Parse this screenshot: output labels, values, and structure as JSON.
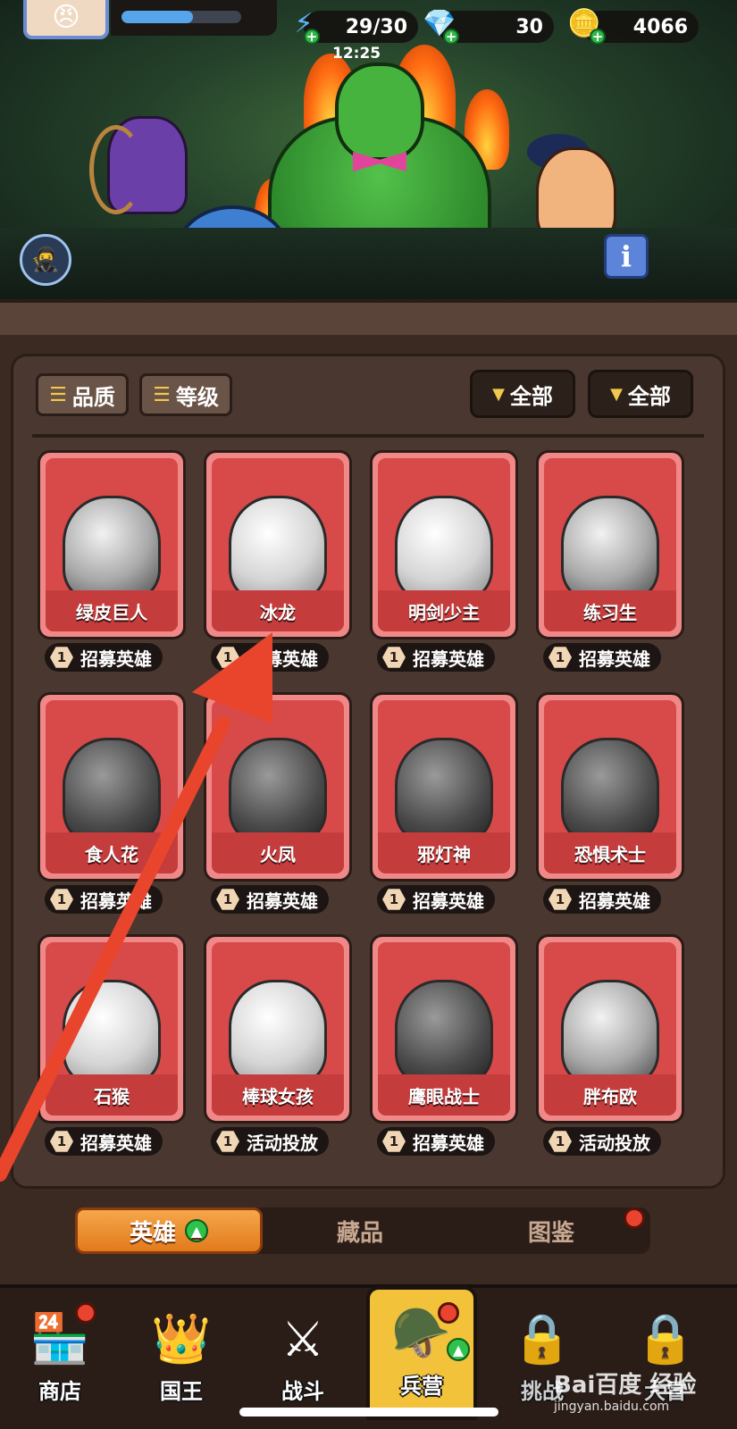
{
  "hud": {
    "energy": "29/30",
    "energy_timer": "12:25",
    "gems": "30",
    "gold": "4066",
    "xp_fraction": 0.6
  },
  "filters": {
    "quality_label": "品质",
    "level_label": "等级",
    "dropdown1_label": "全部",
    "dropdown2_label": "全部"
  },
  "heroes": [
    {
      "name": "绿皮巨人",
      "count": "1",
      "status": "招募英雄"
    },
    {
      "name": "冰龙",
      "count": "1",
      "status": "招募英雄"
    },
    {
      "name": "明剑少主",
      "count": "1",
      "status": "招募英雄"
    },
    {
      "name": "练习生",
      "count": "1",
      "status": "招募英雄"
    },
    {
      "name": "食人花",
      "count": "1",
      "status": "招募英雄"
    },
    {
      "name": "火凤",
      "count": "1",
      "status": "招募英雄"
    },
    {
      "name": "邪灯神",
      "count": "1",
      "status": "招募英雄"
    },
    {
      "name": "恐惧术士",
      "count": "1",
      "status": "招募英雄"
    },
    {
      "name": "石猴",
      "count": "1",
      "status": "招募英雄"
    },
    {
      "name": "棒球女孩",
      "count": "1",
      "status": "活动投放"
    },
    {
      "name": "鹰眼战士",
      "count": "1",
      "status": "招募英雄"
    },
    {
      "name": "胖布欧",
      "count": "1",
      "status": "活动投放"
    }
  ],
  "subtabs": {
    "heroes": "英雄",
    "collection": "藏品",
    "codex": "图鉴"
  },
  "nav": {
    "shop": "商店",
    "king": "国王",
    "battle": "战斗",
    "barracks": "兵营",
    "challenge": "挑战",
    "extra": "大冒"
  },
  "watermark": {
    "brand": "Bai百度 经验",
    "url": "jingyan.baidu.com"
  },
  "colors": {
    "card_bg": "#d84a4a",
    "card_border": "#f08888",
    "active_tab": "#e27a1d",
    "active_nav": "#f1c23a",
    "annotation_arrow": "#e8452c"
  }
}
